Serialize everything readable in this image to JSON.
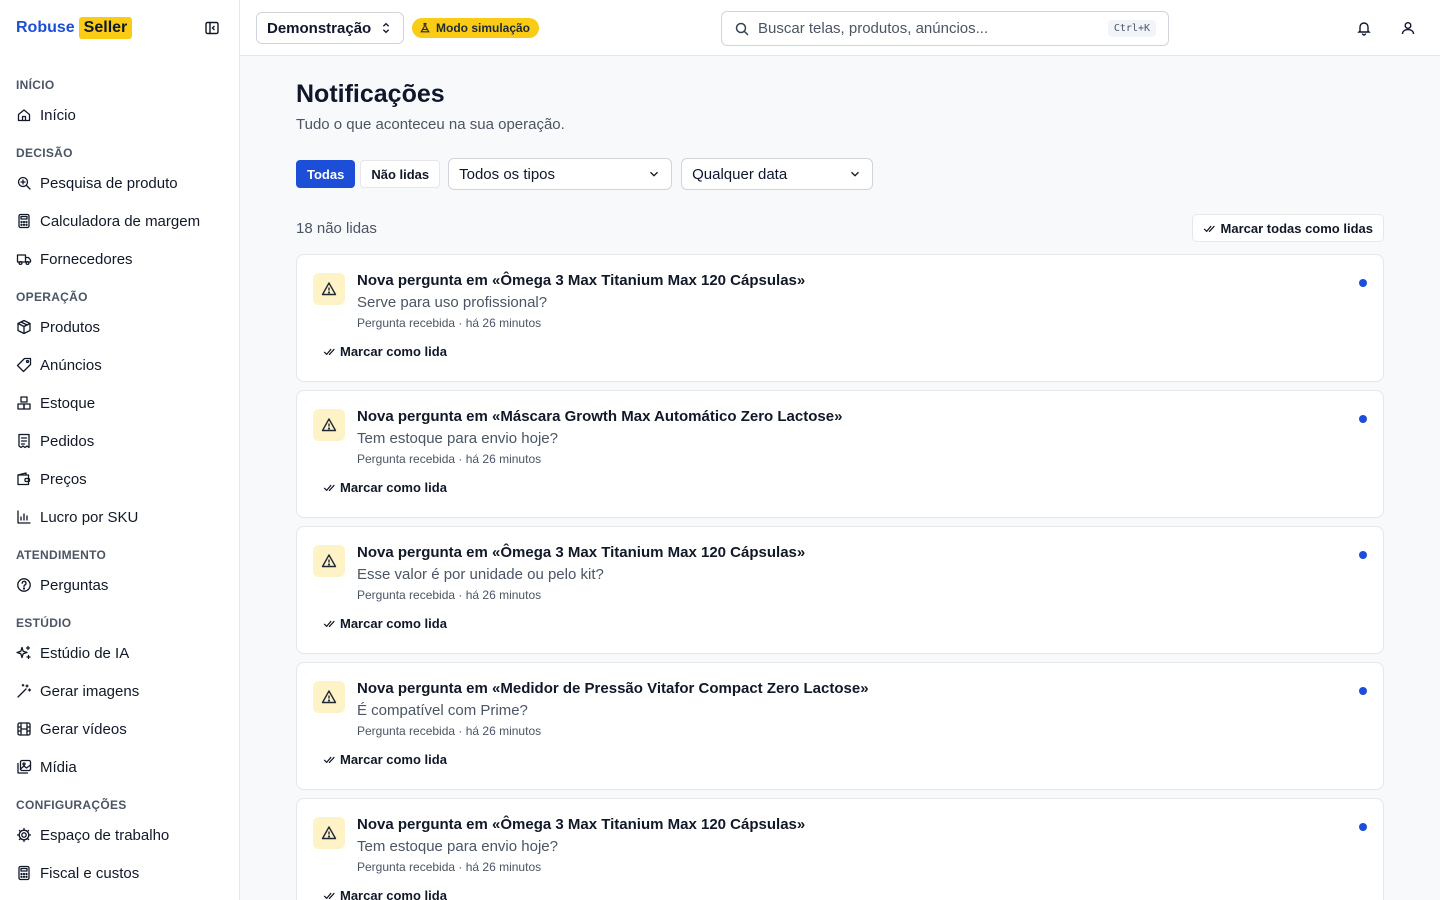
{
  "brand": {
    "part1": "Robuse",
    "part2": "Seller"
  },
  "sidebar": {
    "sections": [
      {
        "title": "INÍCIO",
        "items": [
          {
            "label": "Início",
            "icon": "home-icon"
          }
        ]
      },
      {
        "title": "DECISÃO",
        "items": [
          {
            "label": "Pesquisa de produto",
            "icon": "search-zoom-icon"
          },
          {
            "label": "Calculadora de margem",
            "icon": "calculator-icon"
          },
          {
            "label": "Fornecedores",
            "icon": "truck-icon"
          }
        ]
      },
      {
        "title": "OPERAÇÃO",
        "items": [
          {
            "label": "Produtos",
            "icon": "package-icon"
          },
          {
            "label": "Anúncios",
            "icon": "tag-icon"
          },
          {
            "label": "Estoque",
            "icon": "boxes-icon"
          },
          {
            "label": "Pedidos",
            "icon": "receipt-icon"
          },
          {
            "label": "Preços",
            "icon": "wallet-icon"
          },
          {
            "label": "Lucro por SKU",
            "icon": "bar-chart-icon"
          }
        ]
      },
      {
        "title": "ATENDIMENTO",
        "items": [
          {
            "label": "Perguntas",
            "icon": "help-circle-icon"
          }
        ]
      },
      {
        "title": "ESTÚDIO",
        "items": [
          {
            "label": "Estúdio de IA",
            "icon": "sparkles-icon"
          },
          {
            "label": "Gerar imagens",
            "icon": "wand-icon"
          },
          {
            "label": "Gerar vídeos",
            "icon": "film-icon"
          },
          {
            "label": "Mídia",
            "icon": "images-icon"
          }
        ]
      },
      {
        "title": "CONFIGURAÇÕES",
        "items": [
          {
            "label": "Espaço de trabalho",
            "icon": "gear-icon"
          },
          {
            "label": "Fiscal e custos",
            "icon": "calculator-icon"
          }
        ]
      }
    ]
  },
  "topbar": {
    "workspace": "Demonstração",
    "sim_badge": "Modo simulação",
    "search_placeholder": "Buscar telas, produtos, anúncios...",
    "search_shortcut": "Ctrl+K"
  },
  "page": {
    "title": "Notificações",
    "subtitle": "Tudo o que aconteceu na sua operação.",
    "filters": {
      "all": "Todas",
      "unread": "Não lidas",
      "type_select": "Todos os tipos",
      "date_select": "Qualquer data"
    },
    "unread_count": "18 não lidas",
    "mark_all": "Marcar todas como lidas"
  },
  "notifications": [
    {
      "title": "Nova pergunta em «Ômega 3 Max Titanium Max 120 Cápsulas»",
      "body": "Serve para uso profissional?",
      "meta": "Pergunta recebida · há 26 minutos",
      "action": "Marcar como lida"
    },
    {
      "title": "Nova pergunta em «Máscara Growth Max Automático Zero Lactose»",
      "body": "Tem estoque para envio hoje?",
      "meta": "Pergunta recebida · há 26 minutos",
      "action": "Marcar como lida"
    },
    {
      "title": "Nova pergunta em «Ômega 3 Max Titanium Max 120 Cápsulas»",
      "body": "Esse valor é por unidade ou pelo kit?",
      "meta": "Pergunta recebida · há 26 minutos",
      "action": "Marcar como lida"
    },
    {
      "title": "Nova pergunta em «Medidor de Pressão Vitafor Compact Zero Lactose»",
      "body": "É compatível com Prime?",
      "meta": "Pergunta recebida · há 26 minutos",
      "action": "Marcar como lida"
    },
    {
      "title": "Nova pergunta em «Ômega 3 Max Titanium Max 120 Cápsulas»",
      "body": "Tem estoque para envio hoje?",
      "meta": "Pergunta recebida · há 26 minutos",
      "action": "Marcar como lida"
    }
  ],
  "colors": {
    "accent": "#1d4ed8",
    "brand_yellow": "#facc15",
    "warning_bg": "#fef3c7"
  }
}
